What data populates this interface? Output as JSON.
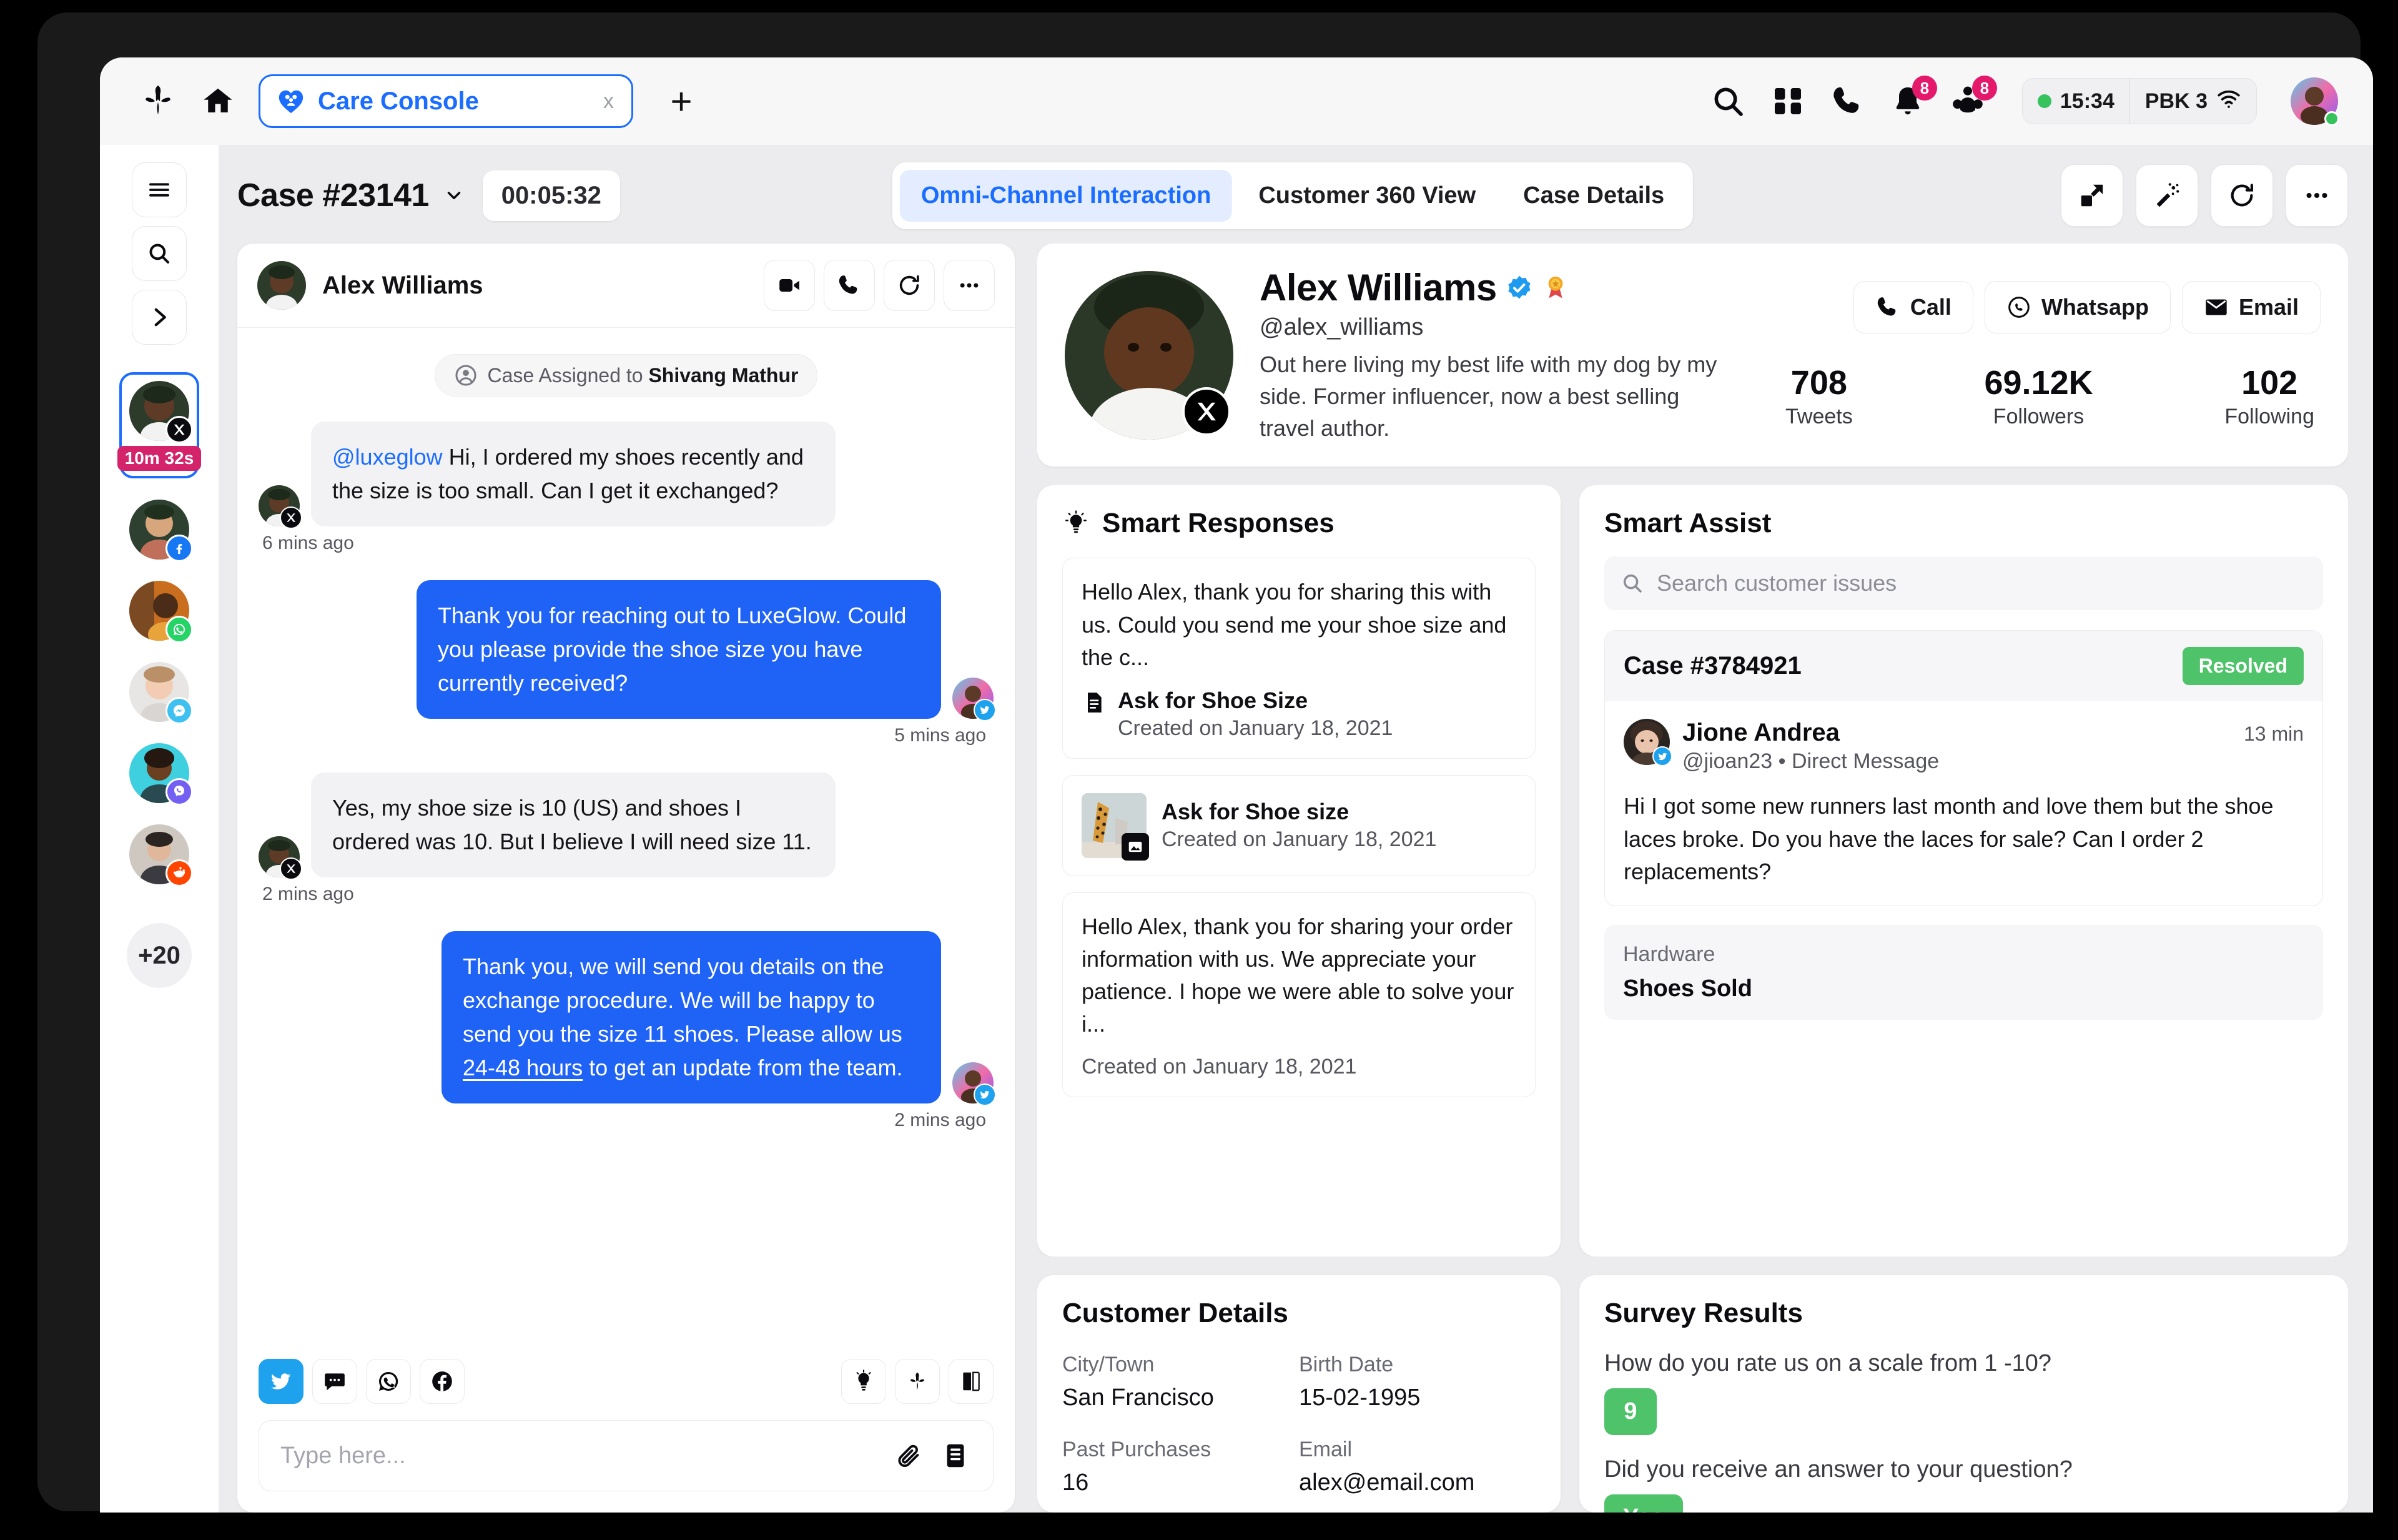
{
  "browser": {
    "brand_logo_icon": "sprinklr-logo-icon",
    "home_icon": "home-icon",
    "tab": {
      "title": "Care Console",
      "favicon_icon": "care-console-favicon-icon",
      "close_label": "x"
    },
    "new_tab_label": "+",
    "header_icons": [
      {
        "name": "search-icon",
        "badge": null
      },
      {
        "name": "apps-grid-icon",
        "badge": null
      },
      {
        "name": "phone-icon",
        "badge": null
      },
      {
        "name": "bell-icon",
        "badge": "8"
      },
      {
        "name": "people-icon",
        "badge": "8"
      }
    ],
    "status": {
      "time": "15:34",
      "network": "PBK 3",
      "wifi_icon": "wifi-icon",
      "presence": "online"
    }
  },
  "left_rail": {
    "buttons": [
      {
        "name": "menu-icon",
        "label": "Menu"
      },
      {
        "name": "search-icon",
        "label": "Search"
      },
      {
        "name": "chevron-right-icon",
        "label": "Expand"
      }
    ],
    "conversations": [
      {
        "channel": "x",
        "timer": "10m 32s",
        "active": true
      },
      {
        "channel": "facebook",
        "timer": null,
        "active": false
      },
      {
        "channel": "whatsapp",
        "timer": null,
        "active": false
      },
      {
        "channel": "messenger",
        "timer": null,
        "active": false
      },
      {
        "channel": "viber",
        "timer": null,
        "active": false
      },
      {
        "channel": "reddit",
        "timer": null,
        "active": false
      }
    ],
    "more_label": "+20"
  },
  "case_bar": {
    "case_title": "Case #23141",
    "chevron_icon": "chevron-down-icon",
    "timer": "00:05:32",
    "tabs": [
      {
        "label": "Omni-Channel Interaction",
        "active": true
      },
      {
        "label": "Customer 360 View",
        "active": false
      },
      {
        "label": "Case Details",
        "active": false
      }
    ],
    "actions": [
      {
        "name": "open-in-new-icon"
      },
      {
        "name": "magic-wand-icon"
      },
      {
        "name": "refresh-icon"
      },
      {
        "name": "more-options-icon"
      }
    ]
  },
  "chat": {
    "header": {
      "name": "Alex Williams",
      "actions": [
        {
          "name": "video-call-icon"
        },
        {
          "name": "phone-call-icon"
        },
        {
          "name": "refresh-icon"
        },
        {
          "name": "more-options-icon"
        }
      ]
    },
    "assigned_notice": {
      "prefix": "Case Assigned to ",
      "assignee": "Shivang Mathur",
      "icon": "user-circle-icon"
    },
    "messages": [
      {
        "direction": "in",
        "mention": "@luxeglow",
        "text": " Hi, I ordered my shoes recently and the size is too small. Can I get it exchanged?",
        "time": "6 mins ago",
        "channel": "x"
      },
      {
        "direction": "out",
        "mention": "",
        "text": "Thank you for reaching out to LuxeGlow. Could you please provide the shoe size you have currently received?",
        "time": "5 mins ago",
        "channel": "twitter"
      },
      {
        "direction": "in",
        "mention": "",
        "text": "Yes, my shoe size is 10 (US) and shoes I ordered was 10. But I believe I will need size 11.",
        "time": "2 mins ago",
        "channel": "x"
      },
      {
        "direction": "out",
        "mention": "",
        "text_before": "Thank you, we will send you details on the exchange procedure. We will be happy to send you the size 11 shoes. Please allow us ",
        "text_link": "24-48 hours",
        "text_after": " to get an update from the team.",
        "text": "Thank you, we will send you details on the exchange procedure. We will be happy to send you the size 11 shoes. Please allow us 24-48 hours to get an update from the team.",
        "time": "2 mins ago",
        "channel": "twitter"
      }
    ],
    "channels": [
      {
        "name": "twitter-icon",
        "active": true
      },
      {
        "name": "sms-icon",
        "active": false
      },
      {
        "name": "whatsapp-icon",
        "active": false
      },
      {
        "name": "facebook-icon",
        "active": false
      }
    ],
    "tools": [
      {
        "name": "lightbulb-icon"
      },
      {
        "name": "sprinklr-logo-icon"
      },
      {
        "name": "knowledge-base-icon"
      }
    ],
    "composer": {
      "placeholder": "Type here...",
      "value": "",
      "attachment_icon": "paperclip-icon",
      "template_icon": "template-icon"
    }
  },
  "profile": {
    "name": "Alex Williams",
    "verified_icon": "verified-badge-icon",
    "award_icon": "award-medal-icon",
    "handle": "@alex_williams",
    "bio": "Out here living my best life with my dog by my side. Former influencer, now a best selling travel author.",
    "channel_badge": "x",
    "actions": [
      {
        "label": "Call",
        "icon": "phone-icon"
      },
      {
        "label": "Whatsapp",
        "icon": "whatsapp-icon"
      },
      {
        "label": "Email",
        "icon": "email-icon"
      }
    ],
    "stats": [
      {
        "value": "708",
        "label": "Tweets"
      },
      {
        "value": "69.12K",
        "label": "Followers"
      },
      {
        "value": "102",
        "label": "Following"
      }
    ]
  },
  "smart_responses": {
    "title": "Smart Responses",
    "icon": "lightbulb-icon",
    "items": [
      {
        "type": "text",
        "text": "Hello Alex, thank you for sharing this with us. Could you send me your shoe size and the c...",
        "meta_icon": "document-icon",
        "meta_title": "Ask for Shoe Size",
        "meta_date": "Created on January 18, 2021"
      },
      {
        "type": "image",
        "thumb_badge_icon": "image-icon",
        "meta_title": "Ask for Shoe size",
        "meta_date": "Created on January 18, 2021"
      },
      {
        "type": "text",
        "text": "Hello Alex, thank you for sharing your order information with us. We appreciate your patience. I hope we were able to solve your i...",
        "meta_date": "Created on January 18, 2021"
      }
    ]
  },
  "smart_assist": {
    "title": "Smart Assist",
    "search_placeholder": "Search customer issues",
    "search_value": "",
    "search_icon": "search-icon",
    "case": {
      "number": "Case #3784921",
      "status": "Resolved",
      "status_color": "#4fc36a",
      "person_name": "Jione Andrea",
      "person_sub": "@jioan23 • Direct Message",
      "person_channel": "twitter",
      "time": "13 min",
      "body": "Hi I got some new runners last month and love them but the shoe laces broke. Do you have the laces for sale? Can I order 2 replacements?"
    },
    "hardware": {
      "label": "Hardware",
      "value": "Shoes Sold"
    }
  },
  "customer_details": {
    "title": "Customer Details",
    "fields": [
      {
        "label": "City/Town",
        "value": "San Francisco"
      },
      {
        "label": "Birth Date",
        "value": "15-02-1995"
      },
      {
        "label": "Past Purchases",
        "value": "16"
      },
      {
        "label": "Email",
        "value": "alex@email.com"
      }
    ]
  },
  "survey_results": {
    "title": "Survey Results",
    "items": [
      {
        "question": "How do you rate us on a scale from 1 -10?",
        "answer": "9"
      },
      {
        "question": "Did you receive an answer to your question?",
        "answer": "Yes"
      }
    ]
  },
  "colors": {
    "accent_blue": "#1a6dff",
    "bubble_blue": "#1f62f6",
    "badge_pink": "#e5196c",
    "timer_pink": "#d4226b",
    "status_green": "#4fc36a",
    "twitter_blue": "#1fa2ee"
  }
}
